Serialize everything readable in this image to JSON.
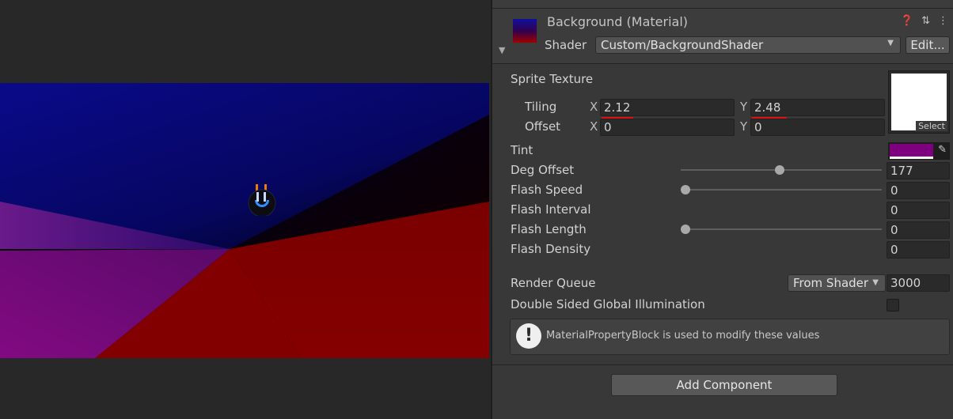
{
  "header": {
    "material_title": "Background (Material)",
    "shader_label": "Shader",
    "shader_value": "Custom/BackgroundShader",
    "edit_button": "Edit...",
    "icons": [
      "help-icon",
      "preset-icon",
      "more-icon"
    ]
  },
  "properties": {
    "sprite_texture": {
      "label": "Sprite Texture",
      "select_label": "Select",
      "tiling": {
        "label": "Tiling",
        "x_axis": "X",
        "x": "2.12",
        "y_axis": "Y",
        "y": "2.48"
      },
      "offset": {
        "label": "Offset",
        "x_axis": "X",
        "x": "0",
        "y_axis": "Y",
        "y": "0"
      }
    },
    "tint": {
      "label": "Tint",
      "color": "#7e007e"
    },
    "deg_offset": {
      "label": "Deg Offset",
      "value": "177",
      "slider_fraction": 0.49
    },
    "flash_speed": {
      "label": "Flash Speed",
      "value": "0",
      "slider_fraction": 0
    },
    "flash_interval": {
      "label": "Flash Interval",
      "value": "0"
    },
    "flash_length": {
      "label": "Flash Length",
      "value": "0",
      "slider_fraction": 0
    },
    "flash_density": {
      "label": "Flash Density",
      "value": "0"
    }
  },
  "render_queue": {
    "label": "Render Queue",
    "mode": "From Shader",
    "value": "3000"
  },
  "double_sided_gi": {
    "label": "Double Sided Global Illumination",
    "checked": false
  },
  "help": {
    "text": "MaterialPropertyBlock is used to modify these values"
  },
  "add_component": "Add Component",
  "colors": {
    "accent_underline": "#e01010",
    "game_blue": "#0a0a8c",
    "game_red": "#8a0000",
    "game_purple": "#7a0a7a"
  }
}
